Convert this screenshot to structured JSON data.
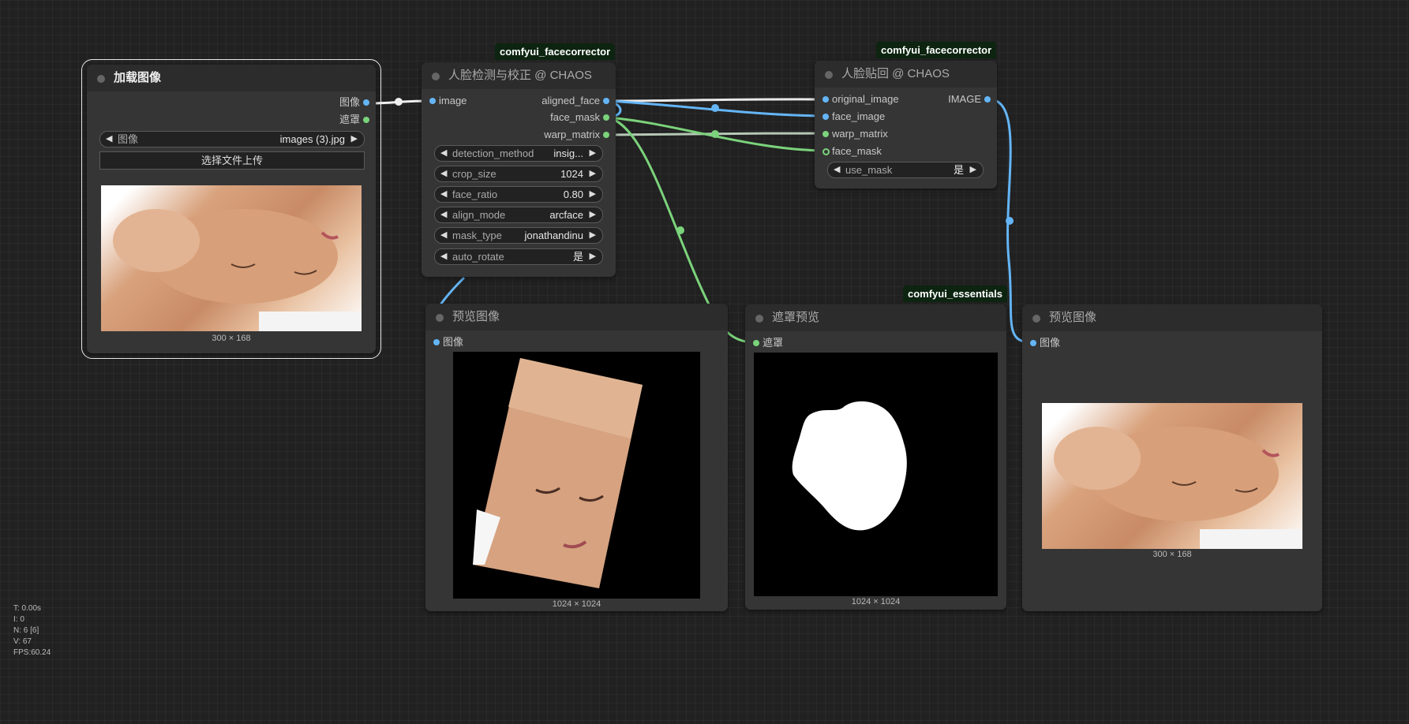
{
  "badges": {
    "face_detect": "comfyui_facecorrector",
    "face_paste": "comfyui_facecorrector",
    "mask_preview": "comfyui_essentials"
  },
  "load_image": {
    "title": "加载图像",
    "outputs": [
      "图像",
      "遮罩"
    ],
    "image_widget": {
      "label": "图像",
      "value": "images (3).jpg"
    },
    "upload_button": "选择文件上传",
    "dimensions": "300 × 168"
  },
  "face_detect": {
    "title": "人脸检测与校正 @ CHAOS",
    "input": "image",
    "outputs": [
      "aligned_face",
      "face_mask",
      "warp_matrix"
    ],
    "widgets": [
      {
        "label": "detection_method",
        "value": "insig..."
      },
      {
        "label": "crop_size",
        "value": "1024"
      },
      {
        "label": "face_ratio",
        "value": "0.80"
      },
      {
        "label": "align_mode",
        "value": "arcface"
      },
      {
        "label": "mask_type",
        "value": "jonathandinu"
      },
      {
        "label": "auto_rotate",
        "value": "是"
      }
    ]
  },
  "face_paste": {
    "title": "人脸贴回 @ CHAOS",
    "inputs": [
      "original_image",
      "face_image",
      "warp_matrix",
      "face_mask"
    ],
    "output": "IMAGE",
    "widget": {
      "label": "use_mask",
      "value": "是"
    }
  },
  "preview1": {
    "title": "预览图像",
    "input": "图像",
    "dimensions": "1024 × 1024"
  },
  "mask_preview": {
    "title": "遮罩预览",
    "input": "遮罩",
    "dimensions": "1024 × 1024"
  },
  "preview2": {
    "title": "预览图像",
    "input": "图像",
    "dimensions": "300 × 168"
  },
  "stats": [
    "T: 0.00s",
    "I: 0",
    "N: 6 [6]",
    "V: 67",
    "FPS:60.24"
  ],
  "colors": {
    "image_link": "#64b5f6",
    "mask_link": "#7bd37b",
    "canvas": "#212121",
    "node": "#353535"
  }
}
